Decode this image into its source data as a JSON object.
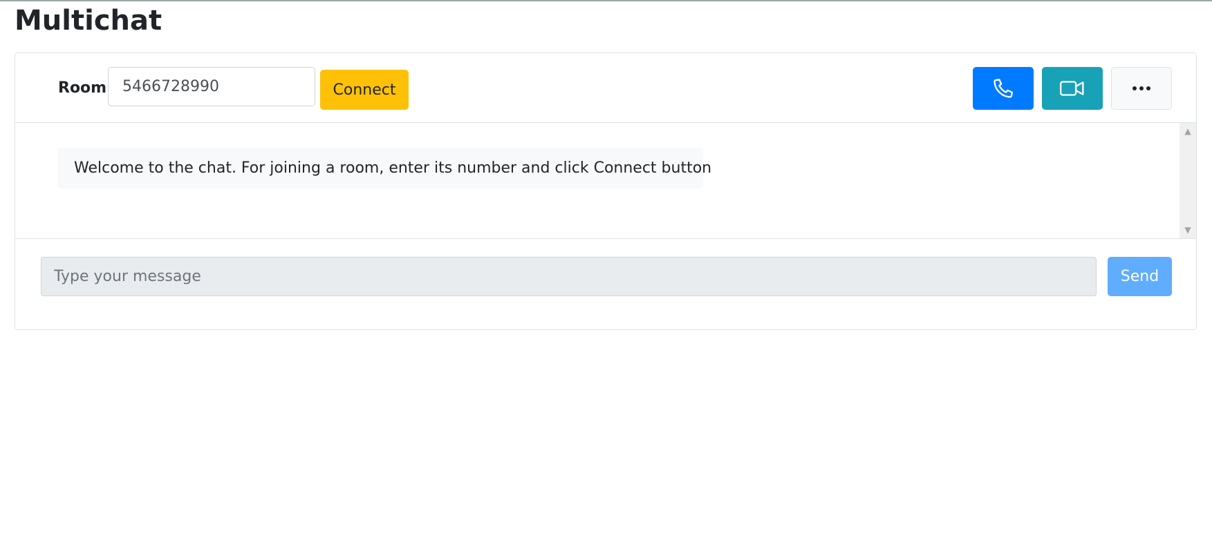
{
  "page": {
    "title": "Multichat"
  },
  "header": {
    "room_label": "Room",
    "room_value": "5466728990",
    "connect_label": "Connect",
    "actions": [
      {
        "icon": "phone-icon",
        "color": "#007bff"
      },
      {
        "icon": "video-camera-icon",
        "color": "#17a2b8"
      },
      {
        "icon": "ellipsis-icon",
        "color": "#f8f9fa"
      }
    ]
  },
  "messages": [
    {
      "text": "Welcome to the chat. For joining a room, enter its number and click Connect button"
    }
  ],
  "composer": {
    "placeholder": "Type your message",
    "send_label": "Send"
  },
  "colors": {
    "connect": "#ffc107",
    "send": "#5fadfc",
    "message_bg": "#f8f9fa",
    "input_disabled_bg": "#e9ecef"
  }
}
